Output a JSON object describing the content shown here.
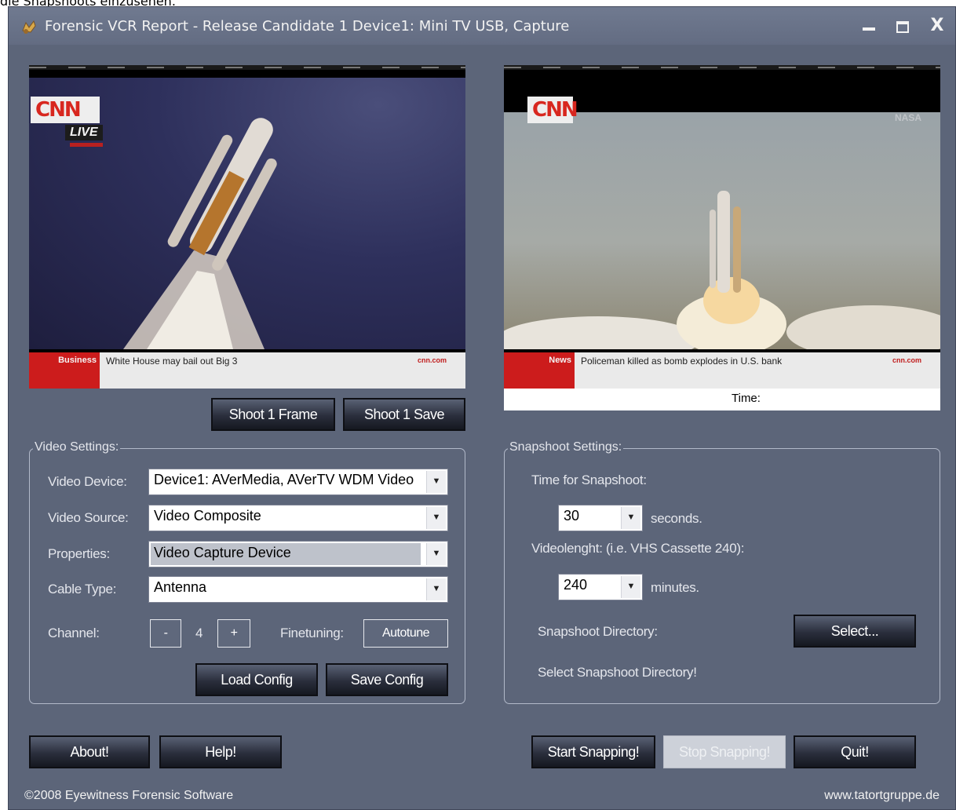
{
  "page_caption": "die Snapshoots einzusehen.",
  "window": {
    "title": "Forensic VCR Report - Release Candidate 1 Device1: Mini TV USB, Capture",
    "close_glyph": "X"
  },
  "left_video": {
    "logo": "CNN",
    "live_badge": "LIVE",
    "ticker_tag": "Business",
    "ticker_text": "White House may bail out Big 3",
    "ticker_brand": "cnn.com"
  },
  "right_video": {
    "logo": "CNN",
    "watermark": "NASA",
    "ticker_tag": "News",
    "ticker_text": "Policeman killed as bomb explodes in U.S. bank",
    "ticker_brand": "cnn.com",
    "time_label": "Time:"
  },
  "shoot_buttons": {
    "shoot_frame": "Shoot 1 Frame",
    "shoot_save": "Shoot 1 Save"
  },
  "video_settings": {
    "title": "Video Settings:",
    "device_label": "Video Device:",
    "device_value": "Device1: AVerMedia, AVerTV WDM Video",
    "source_label": "Video Source:",
    "source_value": "Video Composite",
    "properties_label": "Properties:",
    "properties_value": "Video Capture Device",
    "cable_label": "Cable Type:",
    "cable_value": "Antenna",
    "channel_label": "Channel:",
    "channel_minus": "-",
    "channel_value": "4",
    "channel_plus": "+",
    "finetuning_label": "Finetuning:",
    "autotune": "Autotune",
    "load_config": "Load Config",
    "save_config": "Save Config"
  },
  "snapshot_settings": {
    "title": "Snapshoot Settings:",
    "time_label": "Time  for Snapshoot:",
    "time_value": "30",
    "time_unit": "seconds.",
    "length_label": "Videolenght: (i.e. VHS Cassette 240):",
    "length_value": "240",
    "length_unit": "minutes.",
    "directory_label": "Snapshoot Directory:",
    "select_button": "Select...",
    "directory_hint": "Select Snapshoot Directory!"
  },
  "bottom_buttons": {
    "about": "About!",
    "help": "Help!",
    "start": "Start Snapping!",
    "stop": "Stop Snapping!",
    "quit": "Quit!"
  },
  "footer": {
    "copyright": "©2008 Eyewitness Forensic Software",
    "website": "www.tatortgruppe.de"
  }
}
